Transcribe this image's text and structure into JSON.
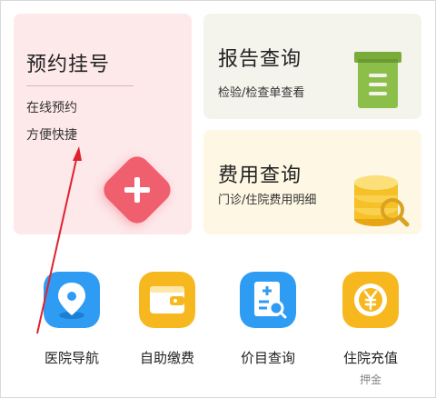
{
  "appointment": {
    "title": "预约挂号",
    "line1": "在线预约",
    "line2": "方便快捷",
    "color": "#f05f6e"
  },
  "report": {
    "title": "报告查询",
    "subtitle": "检验/检查单查看",
    "icon": "document-list-icon",
    "color": "#7aac3c"
  },
  "fee": {
    "title": "费用查询",
    "subtitle": "门诊/住院费用明细",
    "icon": "coin-stack-search-icon",
    "color": "#f6c028"
  },
  "tools": [
    {
      "label": "医院导航",
      "sublabel": "",
      "icon": "map-pin-icon",
      "color": "#2f9cf4"
    },
    {
      "label": "自助缴费",
      "sublabel": "",
      "icon": "wallet-icon",
      "color": "#f7b81f"
    },
    {
      "label": "价目查询",
      "sublabel": "",
      "icon": "price-list-search-icon",
      "color": "#2f9cf4"
    },
    {
      "label": "住院充值",
      "sublabel": "押金",
      "icon": "yen-coin-icon",
      "color": "#f7b81f"
    }
  ],
  "annotation": {
    "color": "#e0222e",
    "icon": "annotation-arrow-icon"
  }
}
